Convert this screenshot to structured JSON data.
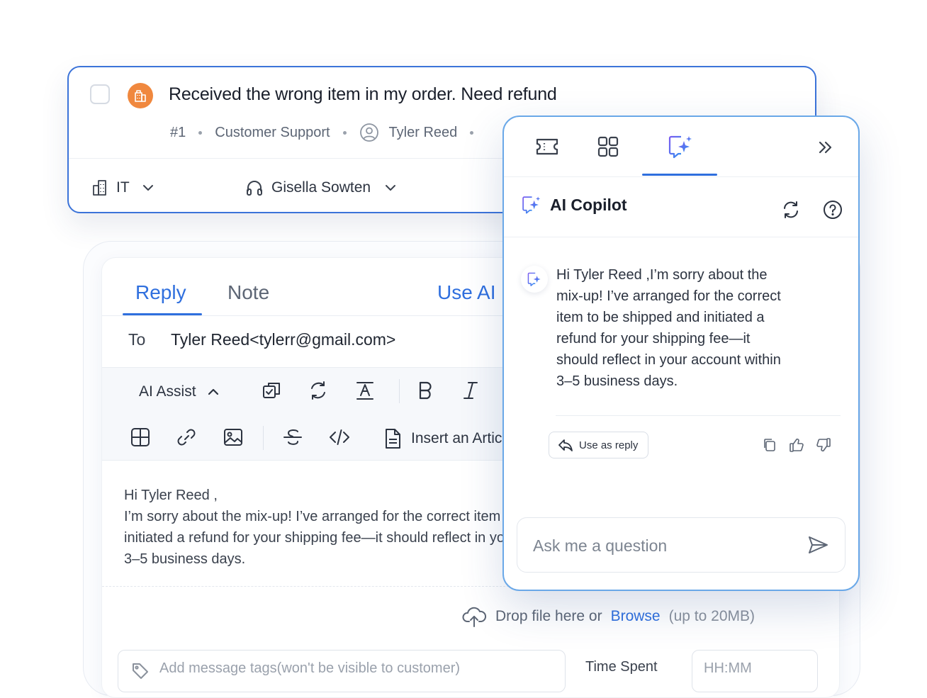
{
  "ticket": {
    "title": "Received the wrong item in my order. Need refund",
    "id": "#1",
    "group": "Customer Support",
    "requester": "Tyler Reed",
    "department": "IT",
    "agent": "Gisella Sowten"
  },
  "composer": {
    "tabs": {
      "reply": "Reply",
      "note": "Note",
      "use_ai": "Use AI"
    },
    "to_label": "To",
    "to_value": "Tyler Reed<tylerr@gmail.com>",
    "toolbar": {
      "ai_assist": "AI Assist",
      "insert_article": "Insert an Article"
    },
    "body_lines": [
      "Hi Tyler Reed ,",
      "I’m sorry about the mix-up! I’ve arranged for the correct item to be shipped and",
      "initiated a refund for your shipping fee—it should reflect in your account within",
      "3–5 business days."
    ],
    "upload": {
      "prefix": "Drop file here or",
      "browse": "Browse",
      "limit": "(up to 20MB)"
    },
    "tags_placeholder": "Add message tags(won't be visible to customer)",
    "time_label": "Time Spent",
    "time_placeholder": "HH:MM"
  },
  "copilot": {
    "title": "AI Copilot",
    "message_lines": [
      "Hi Tyler Reed ,I’m sorry about the",
      "mix-up! I’ve arranged for the correct",
      "item to be shipped and initiated a",
      "refund for your shipping fee—it",
      "should reflect in your account within",
      "3–5 business days."
    ],
    "use_as_reply": "Use as reply",
    "ask_placeholder": "Ask me a question"
  },
  "colors": {
    "accent": "#2f6fde",
    "panel_border": "#6aa8e8",
    "org_badge": "#f0883e"
  }
}
